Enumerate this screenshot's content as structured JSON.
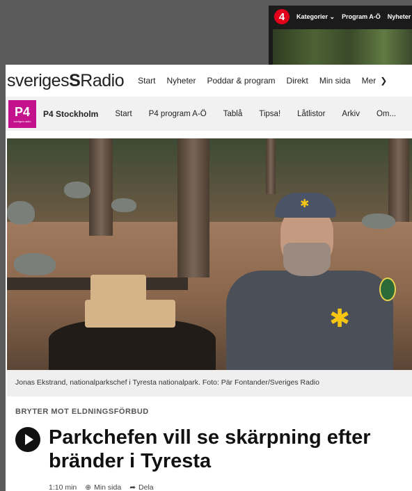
{
  "tv4": {
    "logo": "4",
    "nav": [
      "Kategorier ⌄",
      "Program A-Ö",
      "Nyheter"
    ]
  },
  "sr": {
    "logo_prefix": "sveriges",
    "logo_bold": "S",
    "logo_suffix": "Radio",
    "nav": [
      "Start",
      "Nyheter",
      "Poddar & program",
      "Direkt",
      "Min sida",
      "Mer"
    ]
  },
  "channel": {
    "logo": "P4",
    "logo_sub": "sveriges radio",
    "name": "P4 Stockholm",
    "nav": [
      "Start",
      "P4 program A-Ö",
      "Tablå",
      "Tipsa!",
      "Låtlistor",
      "Arkiv",
      "Om..."
    ]
  },
  "article": {
    "caption": "Jonas Ekstrand, nationalparkschef i Tyresta nationalpark. Foto: Pär Fontander/Sveriges Radio",
    "kicker": "BRYTER MOT ELDNINGSFÖRBUD",
    "headline": "Parkchefen vill se skärpning efter bränder i Tyresta",
    "duration": "1:10 min",
    "min_sida": "Min sida",
    "share": "Dela"
  }
}
